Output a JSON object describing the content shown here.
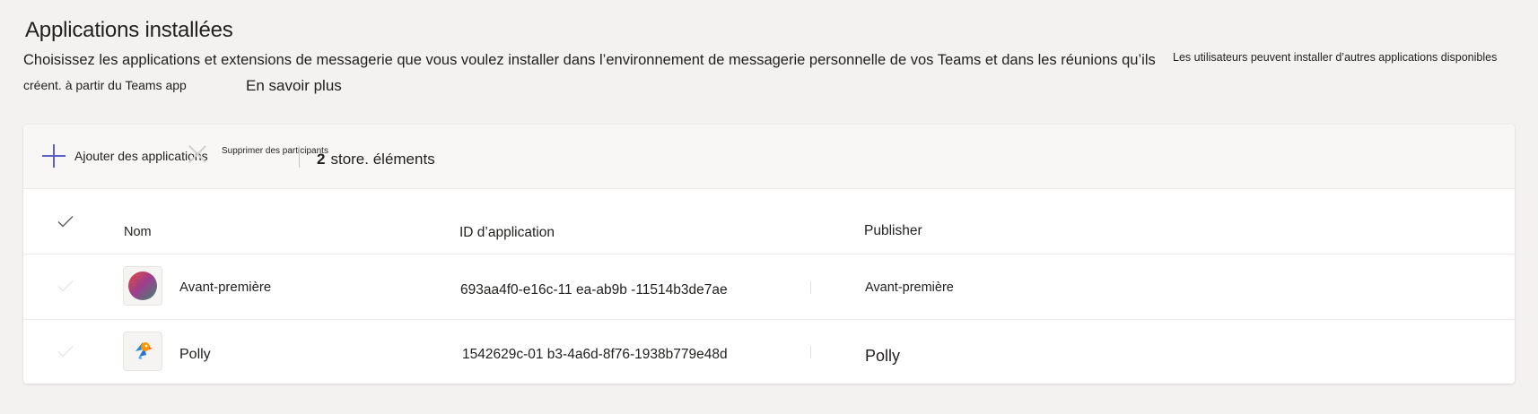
{
  "header": {
    "title": "Applications installées",
    "description": "Choisissez les applications et extensions de messagerie que vous voulez installer dans l’environnement de messagerie personnelle de vos Teams et dans les réunions qu’ils",
    "description_cont": "créent. à partir du Teams app",
    "learn_more": "En savoir plus",
    "side_note": "Les utilisateurs peuvent installer d’autres applications disponibles"
  },
  "toolbar": {
    "add_label": "Ajouter des applications",
    "remove_label": "Supprimer des participants",
    "count_number": "2",
    "count_label": "store. éléments"
  },
  "table": {
    "columns": {
      "name": "Nom",
      "app_id": "ID d’application",
      "publisher": "Publisher"
    },
    "rows": [
      {
        "name": "Avant-première",
        "app_id": "693aa4f0-e16c-11 ea-ab9b      -11514b3de7ae",
        "publisher": "Avant-première",
        "icon": "preview-app-icon"
      },
      {
        "name": "Polly",
        "app_id": "1542629c-01 b3-4a6d-8f76-1938b779e48d",
        "publisher": "Polly",
        "icon": "polly-parrot-icon"
      }
    ]
  },
  "colors": {
    "page_bg": "#f3f2f1",
    "accent": "#5b5fc7",
    "text": "#201f1e"
  }
}
